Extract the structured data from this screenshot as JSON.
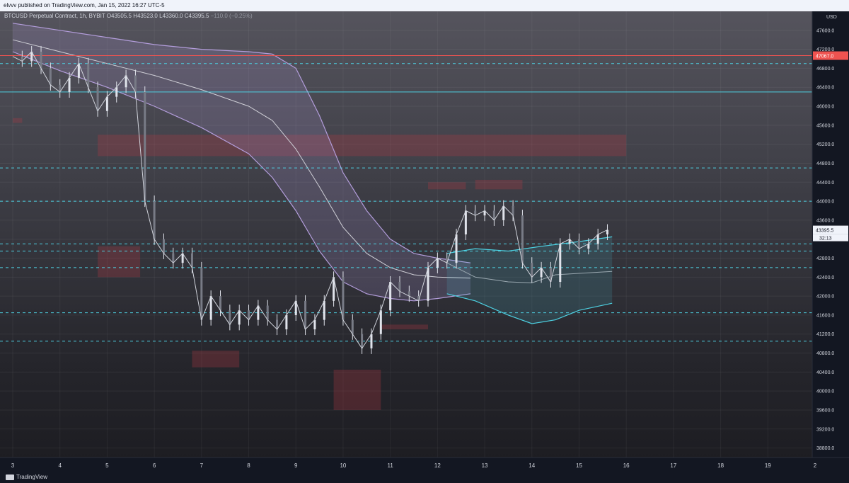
{
  "header": {
    "text": "elvvv published on TradingView.com, Jan 15, 2022 16:27 UTC-5"
  },
  "legend": {
    "symbol": "BTCUSD Perpetual Contract, 1h, BYBIT",
    "open": "O43505.5",
    "high": "H43523.0",
    "low": "L43360.0",
    "close": "C43395.5",
    "change": "−110.0 (−0.25%)"
  },
  "brand": {
    "name": "TradingView",
    "icon": "tradingview-logo-icon"
  },
  "axis": {
    "currency": "USD",
    "countdown": "32:13"
  },
  "chart_data": {
    "type": "line",
    "title": "",
    "ylim": [
      38600,
      48000
    ],
    "y_ticks": [
      38800,
      39200,
      39600,
      40000,
      40400,
      40800,
      41200,
      41600,
      42000,
      42400,
      42800,
      43200,
      43600,
      44000,
      44400,
      44800,
      45200,
      45600,
      46000,
      46400,
      46800,
      47200,
      47600
    ],
    "x_tick_labels": [
      "3",
      "4",
      "5",
      "6",
      "7",
      "8",
      "9",
      "10",
      "11",
      "12",
      "13",
      "14",
      "15",
      "16",
      "17",
      "18",
      "19",
      "2"
    ],
    "grid": true,
    "series": [
      {
        "values": [
          [
            3.0,
            47050
          ],
          [
            3.2,
            46950
          ],
          [
            3.4,
            47150
          ],
          [
            3.6,
            46800
          ],
          [
            3.8,
            46450
          ],
          [
            4.0,
            46300
          ],
          [
            4.2,
            46600
          ],
          [
            4.4,
            46900
          ],
          [
            4.6,
            46400
          ],
          [
            4.8,
            45900
          ],
          [
            5.0,
            46200
          ],
          [
            5.2,
            46400
          ],
          [
            5.4,
            46650
          ],
          [
            5.6,
            46300
          ],
          [
            5.8,
            44000
          ],
          [
            6.0,
            43200
          ],
          [
            6.2,
            42900
          ],
          [
            6.4,
            42700
          ],
          [
            6.6,
            42900
          ],
          [
            6.8,
            42600
          ],
          [
            7.0,
            41500
          ],
          [
            7.2,
            42000
          ],
          [
            7.4,
            41700
          ],
          [
            7.6,
            41400
          ],
          [
            7.8,
            41700
          ],
          [
            8.0,
            41500
          ],
          [
            8.2,
            41800
          ],
          [
            8.4,
            41500
          ],
          [
            8.6,
            41300
          ],
          [
            8.8,
            41600
          ],
          [
            9.0,
            41900
          ],
          [
            9.2,
            41300
          ],
          [
            9.4,
            41500
          ],
          [
            9.6,
            41900
          ],
          [
            9.8,
            42400
          ],
          [
            10.0,
            41500
          ],
          [
            10.2,
            41200
          ],
          [
            10.4,
            40900
          ],
          [
            10.6,
            41200
          ],
          [
            10.8,
            41700
          ],
          [
            11.0,
            42300
          ],
          [
            11.2,
            42100
          ],
          [
            11.4,
            42000
          ],
          [
            11.6,
            41900
          ],
          [
            11.8,
            42600
          ],
          [
            12.0,
            42800
          ],
          [
            12.2,
            42700
          ],
          [
            12.4,
            43300
          ],
          [
            12.6,
            43800
          ],
          [
            12.8,
            43700
          ],
          [
            13.0,
            43800
          ],
          [
            13.2,
            43600
          ],
          [
            13.4,
            43900
          ],
          [
            13.6,
            43700
          ],
          [
            13.8,
            42700
          ],
          [
            14.0,
            42400
          ],
          [
            14.2,
            42600
          ],
          [
            14.4,
            42300
          ],
          [
            14.6,
            43100
          ],
          [
            14.8,
            43200
          ],
          [
            15.0,
            43000
          ],
          [
            15.2,
            43100
          ],
          [
            15.4,
            43300
          ],
          [
            15.6,
            43395
          ]
        ]
      }
    ],
    "bands": [
      {
        "upper": [
          [
            3,
            47750
          ],
          [
            4,
            47600
          ],
          [
            5,
            47450
          ],
          [
            6,
            47300
          ],
          [
            7,
            47200
          ],
          [
            8,
            47150
          ],
          [
            8.5,
            47100
          ],
          [
            9,
            46800
          ],
          [
            9.5,
            45800
          ],
          [
            10,
            44600
          ],
          [
            10.5,
            43800
          ],
          [
            11,
            43200
          ],
          [
            11.5,
            42900
          ],
          [
            12,
            42800
          ],
          [
            12.7,
            42700
          ]
        ],
        "lower": [
          [
            3,
            47150
          ],
          [
            4,
            46750
          ],
          [
            5,
            46400
          ],
          [
            6,
            46000
          ],
          [
            7,
            45550
          ],
          [
            8,
            45000
          ],
          [
            8.5,
            44500
          ],
          [
            9,
            43800
          ],
          [
            9.5,
            42950
          ],
          [
            10,
            42300
          ],
          [
            10.5,
            42050
          ],
          [
            11,
            41950
          ],
          [
            11.5,
            41900
          ],
          [
            12,
            41950
          ],
          [
            12.7,
            42050
          ]
        ],
        "middle": [
          [
            3,
            47400
          ],
          [
            4,
            47150
          ],
          [
            5,
            46900
          ],
          [
            6,
            46650
          ],
          [
            7,
            46350
          ],
          [
            8,
            46000
          ],
          [
            8.5,
            45700
          ],
          [
            9,
            45100
          ],
          [
            9.5,
            44300
          ],
          [
            10,
            43450
          ],
          [
            10.5,
            42900
          ],
          [
            11,
            42600
          ],
          [
            11.5,
            42450
          ],
          [
            12,
            42400
          ],
          [
            12.7,
            42380
          ]
        ]
      },
      {
        "upper": [
          [
            12.2,
            42900
          ],
          [
            12.8,
            43000
          ],
          [
            13.5,
            42950
          ],
          [
            14.2,
            43050
          ],
          [
            15.0,
            43150
          ],
          [
            15.7,
            43250
          ]
        ],
        "lower": [
          [
            12.2,
            42050
          ],
          [
            12.8,
            41900
          ],
          [
            13.5,
            41600
          ],
          [
            14.0,
            41420
          ],
          [
            14.5,
            41500
          ],
          [
            15.0,
            41700
          ],
          [
            15.7,
            41850
          ]
        ],
        "middle": [
          [
            12.2,
            42700
          ],
          [
            12.8,
            42400
          ],
          [
            13.5,
            42300
          ],
          [
            14.0,
            42280
          ],
          [
            14.5,
            42450
          ],
          [
            15.0,
            42480
          ],
          [
            15.7,
            42520
          ]
        ]
      }
    ],
    "levels": [
      {
        "price": 47067,
        "style": "solid",
        "color": "#ef5350"
      },
      {
        "price": 46900,
        "style": "dashed",
        "color": "#4dd0e1"
      },
      {
        "price": 46300,
        "style": "solid",
        "color": "#4dd0e1"
      },
      {
        "price": 44700,
        "style": "dashed",
        "color": "#4dd0e1"
      },
      {
        "price": 44000,
        "style": "dashed",
        "color": "#4dd0e1"
      },
      {
        "price": 43100,
        "style": "dashed",
        "color": "#4dd0e1"
      },
      {
        "price": 42950,
        "style": "dashed",
        "color": "#4dd0e1"
      },
      {
        "price": 42600,
        "style": "dashed",
        "color": "#4dd0e1"
      },
      {
        "price": 41650,
        "style": "dashed",
        "color": "#4dd0e1"
      },
      {
        "price": 41050,
        "style": "dashed",
        "color": "#4dd0e1"
      }
    ],
    "zones": [
      {
        "x0": 3.0,
        "x1": 3.2,
        "y0": 45650,
        "y1": 45750
      },
      {
        "x0": 4.8,
        "x1": 16.0,
        "y0": 44950,
        "y1": 45400
      },
      {
        "x0": 4.8,
        "x1": 5.7,
        "y0": 42400,
        "y1": 43050
      },
      {
        "x0": 6.8,
        "x1": 7.8,
        "y0": 40500,
        "y1": 40850
      },
      {
        "x0": 9.8,
        "x1": 10.8,
        "y0": 39600,
        "y1": 40450
      },
      {
        "x0": 10.8,
        "x1": 11.8,
        "y0": 41300,
        "y1": 41400
      },
      {
        "x0": 11.8,
        "x1": 12.6,
        "y0": 44250,
        "y1": 44400
      },
      {
        "x0": 12.8,
        "x1": 13.8,
        "y0": 44250,
        "y1": 44450
      }
    ],
    "price_labels": [
      {
        "price": 47067,
        "text": "47067.0",
        "color": "#ef5350"
      },
      {
        "price": 43395.5,
        "text": "43395.5",
        "color": "#f0f3fa"
      }
    ],
    "colors": {
      "profile_up": "#5ee1ff",
      "profile_down": "#b388ff",
      "band": "#b39ddb",
      "band2": "#4dd0e1"
    }
  }
}
